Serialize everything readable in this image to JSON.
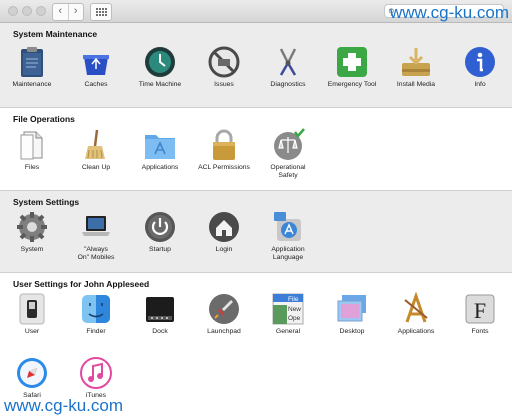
{
  "window": {
    "nav_back": "‹",
    "nav_forward": "›",
    "search_placeholder": ""
  },
  "watermark": "www.cg-ku.com",
  "sections": {
    "maintenance": {
      "title": "System Maintenance",
      "items": [
        "Maintenance",
        "Caches",
        "Time Machine",
        "Issues",
        "Diagnostics",
        "Emergency Tool",
        "Install Media",
        "Info"
      ]
    },
    "file_ops": {
      "title": "File Operations",
      "items": [
        "Files",
        "Clean Up",
        "Applications",
        "ACL Permissions",
        "Operational\nSafety"
      ]
    },
    "system_settings": {
      "title": "System Settings",
      "items": [
        "System",
        "\"Always\nOn\" Mobiles",
        "Startup",
        "Login",
        "Application\nLanguage"
      ]
    },
    "user_settings": {
      "title": "User Settings for John Appleseed",
      "items": [
        "User",
        "Finder",
        "Dock",
        "Launchpad",
        "General",
        "Desktop",
        "Applications",
        "Fonts",
        "Safari",
        "iTunes"
      ],
      "general_icon_text": [
        "File",
        "New",
        "Ope"
      ],
      "fonts_icon_text": "F"
    }
  },
  "colors": {
    "watermark": "#1a73c9",
    "section_gray": "#ececec",
    "section_white": "#ffffff"
  }
}
